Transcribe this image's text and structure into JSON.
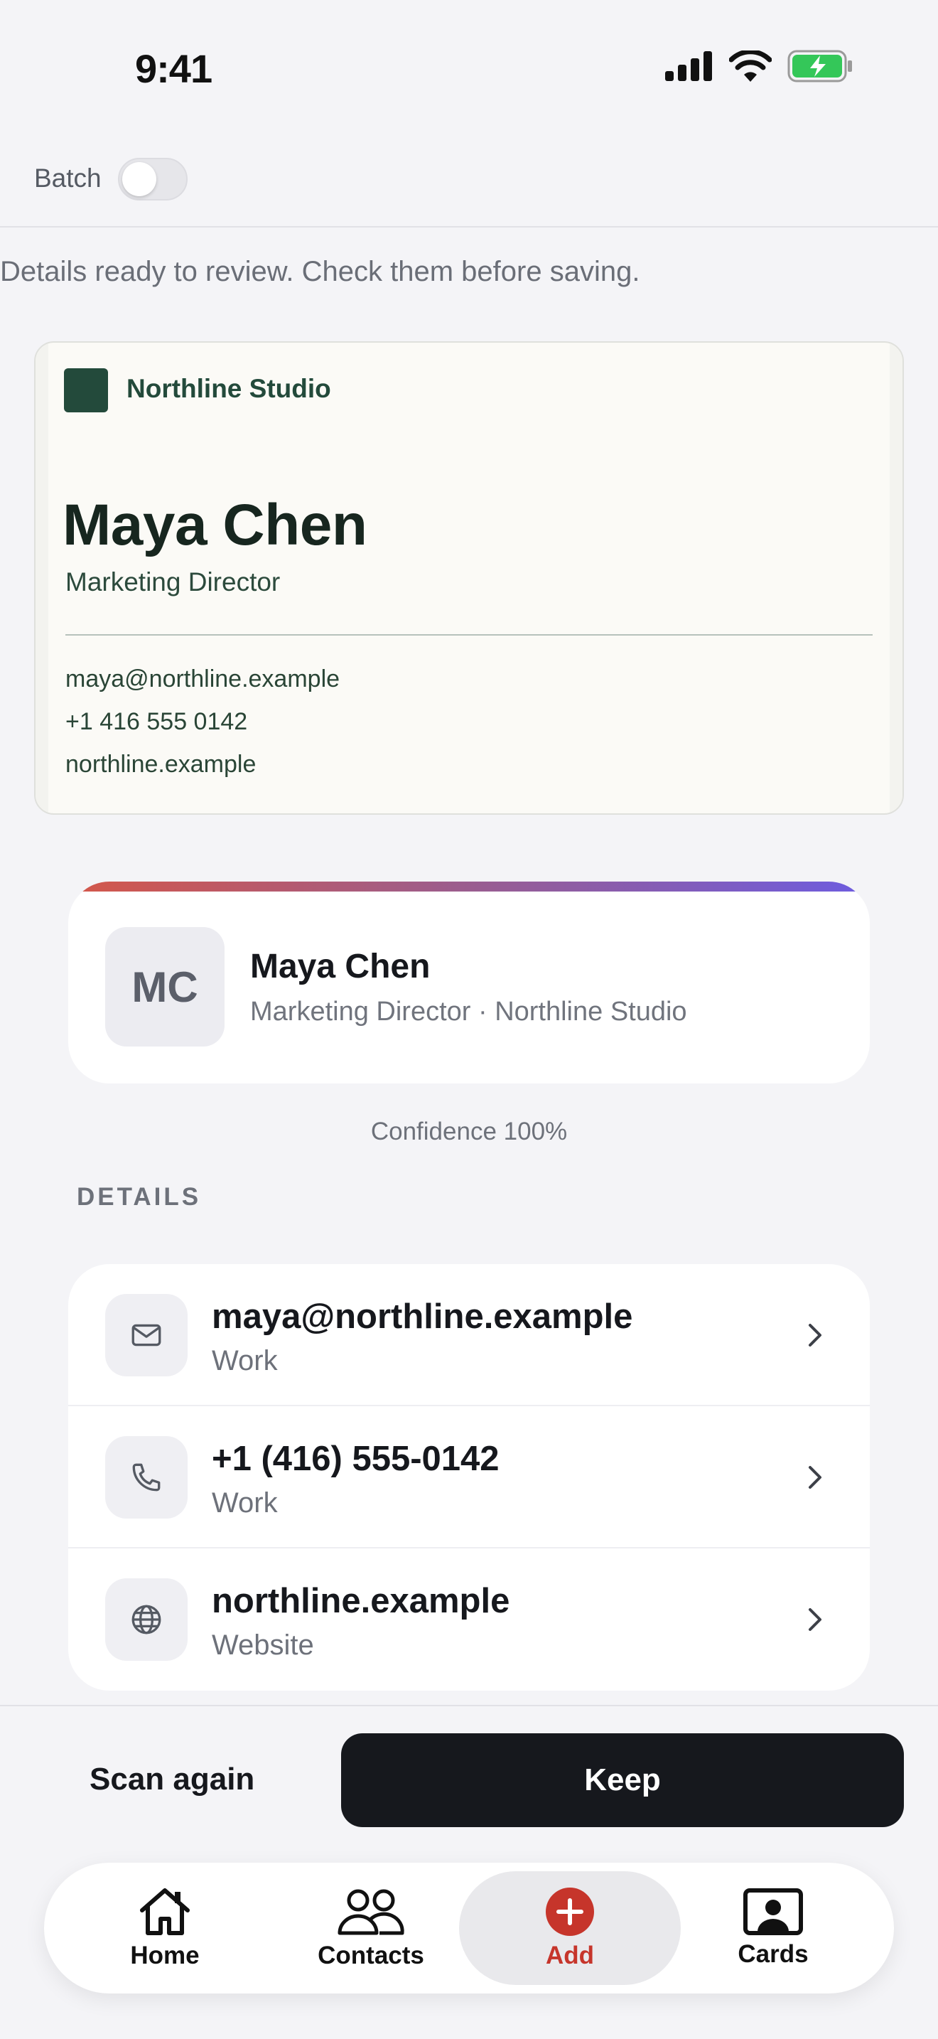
{
  "status_bar": {
    "time": "9:41"
  },
  "batch": {
    "label": "Batch",
    "enabled": false
  },
  "review_message": "Details ready to review. Check them before saving.",
  "scanned_card": {
    "company": "Northline Studio",
    "name": "Maya Chen",
    "title": "Marketing Director",
    "email": "maya@northline.example",
    "phone": "+1 416 555 0142",
    "website": "northline.example",
    "brand_color": "#234a3b"
  },
  "contact": {
    "initials": "MC",
    "name": "Maya Chen",
    "subtitle": "Marketing Director · Northline Studio"
  },
  "confidence": "Confidence 100%",
  "details_header": "DETAILS",
  "details": [
    {
      "icon": "mail-icon",
      "value": "maya@northline.example",
      "label": "Work"
    },
    {
      "icon": "phone-icon",
      "value": "+1 (416) 555-0142",
      "label": "Work"
    },
    {
      "icon": "globe-icon",
      "value": "northline.example",
      "label": "Website"
    }
  ],
  "actions": {
    "scan_again": "Scan again",
    "keep": "Keep"
  },
  "tabs": [
    {
      "label": "Home",
      "icon": "home-icon"
    },
    {
      "label": "Contacts",
      "icon": "contacts-icon"
    },
    {
      "label": "Add",
      "icon": "add-icon",
      "active": true
    },
    {
      "label": "Cards",
      "icon": "cards-icon"
    }
  ],
  "colors": {
    "accent": "#c6352b",
    "primary_button": "#16181d",
    "battery": "#34c759"
  }
}
